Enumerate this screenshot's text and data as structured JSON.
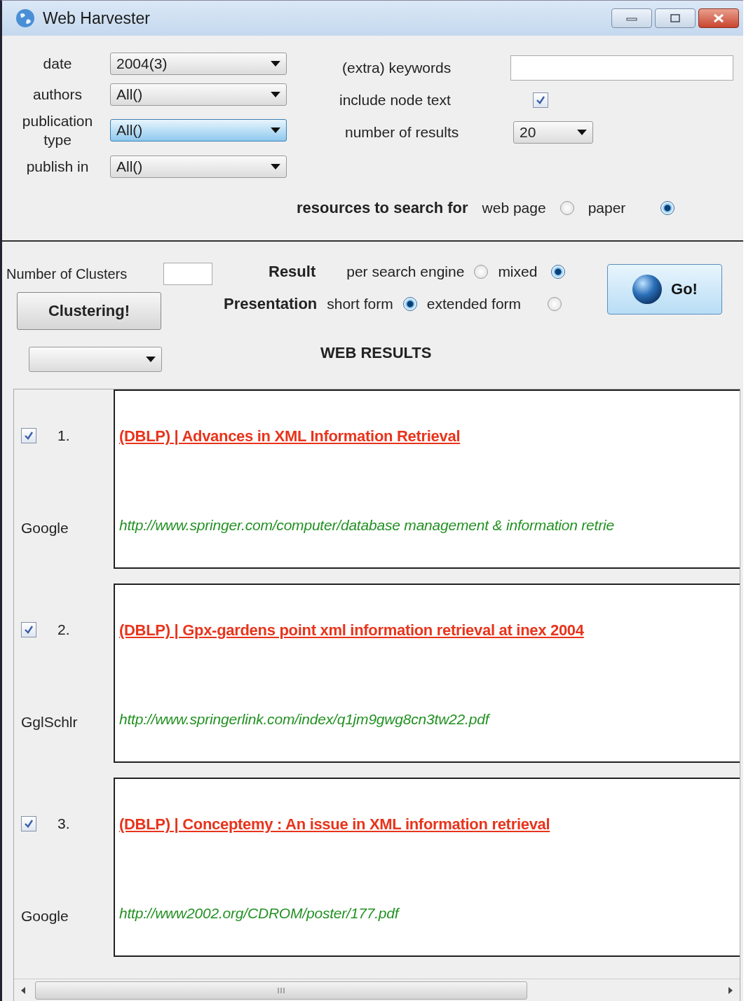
{
  "window": {
    "title": "Web Harvester"
  },
  "filters": [
    {
      "label": "date",
      "value": "2004(3)",
      "focused": false
    },
    {
      "label": "authors",
      "value": "All()",
      "focused": false
    },
    {
      "label": "publication type",
      "value": "All()",
      "focused": true
    },
    {
      "label": "publish in",
      "value": "All()",
      "focused": false
    }
  ],
  "keywords": {
    "label": "(extra) keywords"
  },
  "include_node_text": {
    "label": "include node text",
    "checked": true
  },
  "number_of_results": {
    "label": "number of results",
    "value": "20"
  },
  "resources": {
    "label": "resources to search for",
    "options": [
      {
        "label": "web page",
        "selected": false
      },
      {
        "label": "paper",
        "selected": true
      }
    ]
  },
  "clusters": {
    "label": "Number of Clusters",
    "button": "Clustering!"
  },
  "result_mode": {
    "label": "Result",
    "options": [
      {
        "label": "per search engine",
        "selected": false
      },
      {
        "label": "mixed",
        "selected": true
      }
    ]
  },
  "presentation": {
    "label": "Presentation",
    "options": [
      {
        "label": "short form",
        "selected": true
      },
      {
        "label": "extended form",
        "selected": false
      }
    ]
  },
  "go_button": "Go!",
  "results_heading": "WEB RESULTS",
  "results": [
    {
      "checked": true,
      "number": "1.",
      "source": "Google",
      "title": "(DBLP) | Advances in XML Information Retrieval",
      "url": "http://www.springer.com/computer/database management & information retrie"
    },
    {
      "checked": true,
      "number": "2.",
      "source": "GglSchlr",
      "title": "(DBLP) | Gpx-gardens point xml information retrieval at inex 2004",
      "url": "http://www.springerlink.com/index/q1jm9gwg8cn3tw22.pdf"
    },
    {
      "checked": true,
      "number": "3.",
      "source": "Google",
      "title": "(DBLP) | Conceptemy : An issue in XML information retrieval",
      "url": "http://www2002.org/CDROM/poster/177.pdf"
    }
  ]
}
